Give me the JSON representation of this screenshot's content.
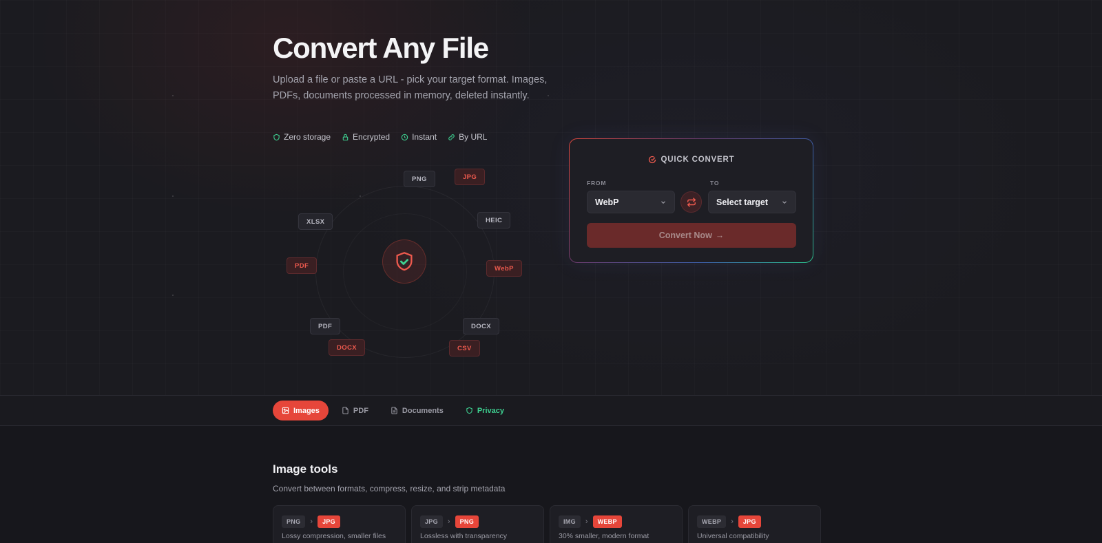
{
  "hero": {
    "title": "Convert Any File",
    "subtitle": "Upload a file or paste a URL - pick your target format. Images, PDFs, documents processed in memory, deleted instantly.",
    "features": [
      {
        "icon": "shield-icon",
        "label": "Zero storage"
      },
      {
        "icon": "lock-icon",
        "label": "Encrypted"
      },
      {
        "icon": "clock-icon",
        "label": "Instant"
      },
      {
        "icon": "link-icon",
        "label": "By URL"
      }
    ]
  },
  "orbit": {
    "center_icon": "shield-check-icon",
    "tags": [
      "PNG",
      "JPG",
      "XLSX",
      "HEIC",
      "PDF",
      "WebP",
      "PDF",
      "DOCX",
      "DOCX",
      "CSV"
    ]
  },
  "quick_convert": {
    "title": "QUICK CONVERT",
    "from_label": "FROM",
    "to_label": "TO",
    "from_value": "WebP",
    "to_value": "Select target",
    "button_label": "Convert Now"
  },
  "tabs": [
    {
      "label": "Images",
      "icon": "image-icon",
      "active": true
    },
    {
      "label": "PDF",
      "icon": "file-icon"
    },
    {
      "label": "Documents",
      "icon": "document-icon"
    },
    {
      "label": "Privacy",
      "icon": "shield-icon"
    }
  ],
  "tools_section": {
    "title": "Image tools",
    "subtitle": "Convert between formats, compress, resize, and strip metadata",
    "cards": [
      {
        "from": "PNG",
        "to": "JPG",
        "desc": "Lossy compression, smaller files"
      },
      {
        "from": "JPG",
        "to": "PNG",
        "desc": "Lossless with transparency"
      },
      {
        "from": "IMG",
        "to": "WEBP",
        "desc": "30% smaller, modern format"
      },
      {
        "from": "WEBP",
        "to": "JPG",
        "desc": "Universal compatibility"
      }
    ]
  },
  "colors": {
    "accent": "#e6463a",
    "success": "#3ed191",
    "background": "#17171c"
  }
}
